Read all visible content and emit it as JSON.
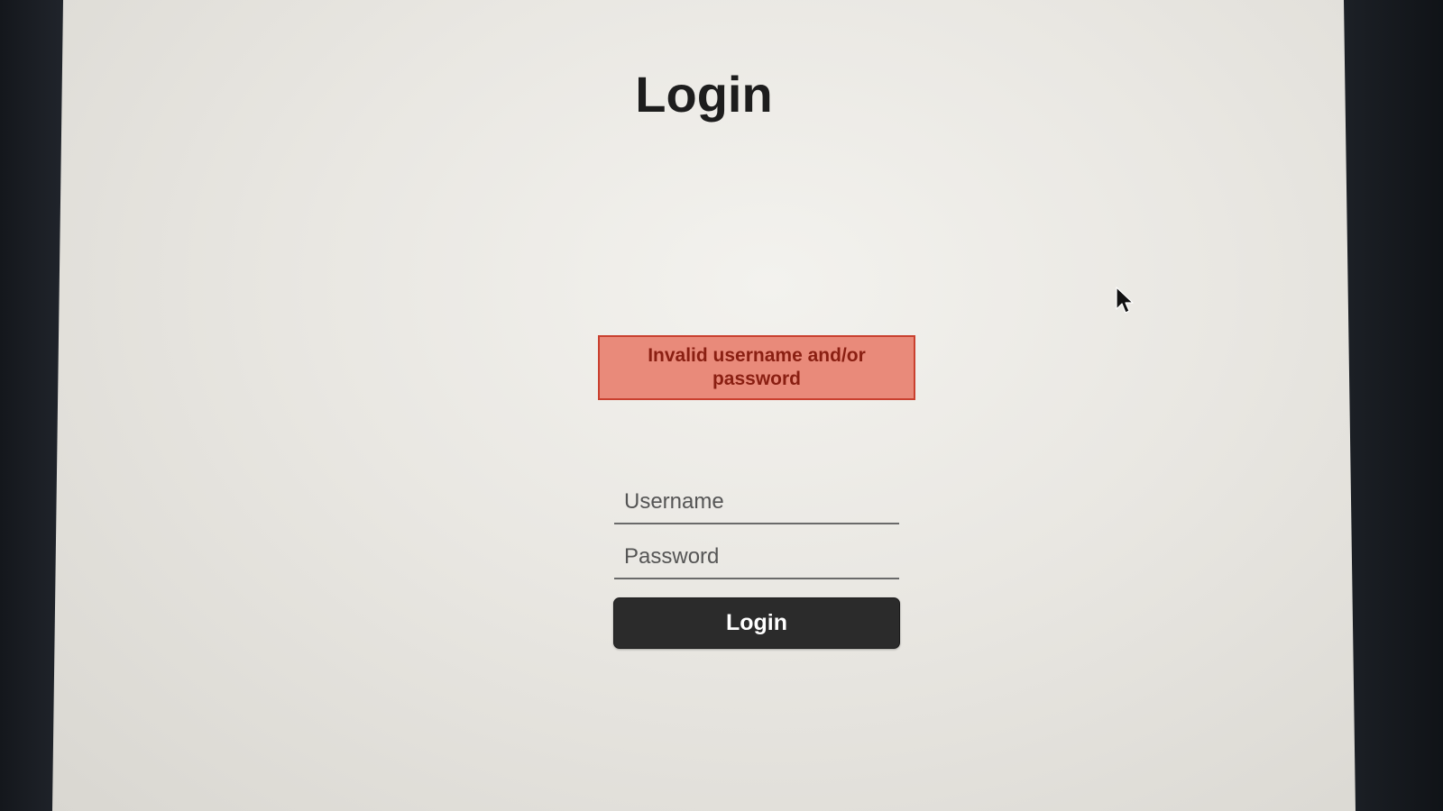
{
  "page": {
    "title": "Login"
  },
  "error": {
    "message": "Invalid username and/or password",
    "color_bg": "#e98a7a",
    "color_border": "#c9402f",
    "color_text": "#8a1f12"
  },
  "form": {
    "username_placeholder": "Username",
    "username_value": "",
    "password_placeholder": "Password",
    "password_value": "",
    "submit_label": "Login"
  },
  "cursor": {
    "icon": "arrow-pointer-icon"
  }
}
